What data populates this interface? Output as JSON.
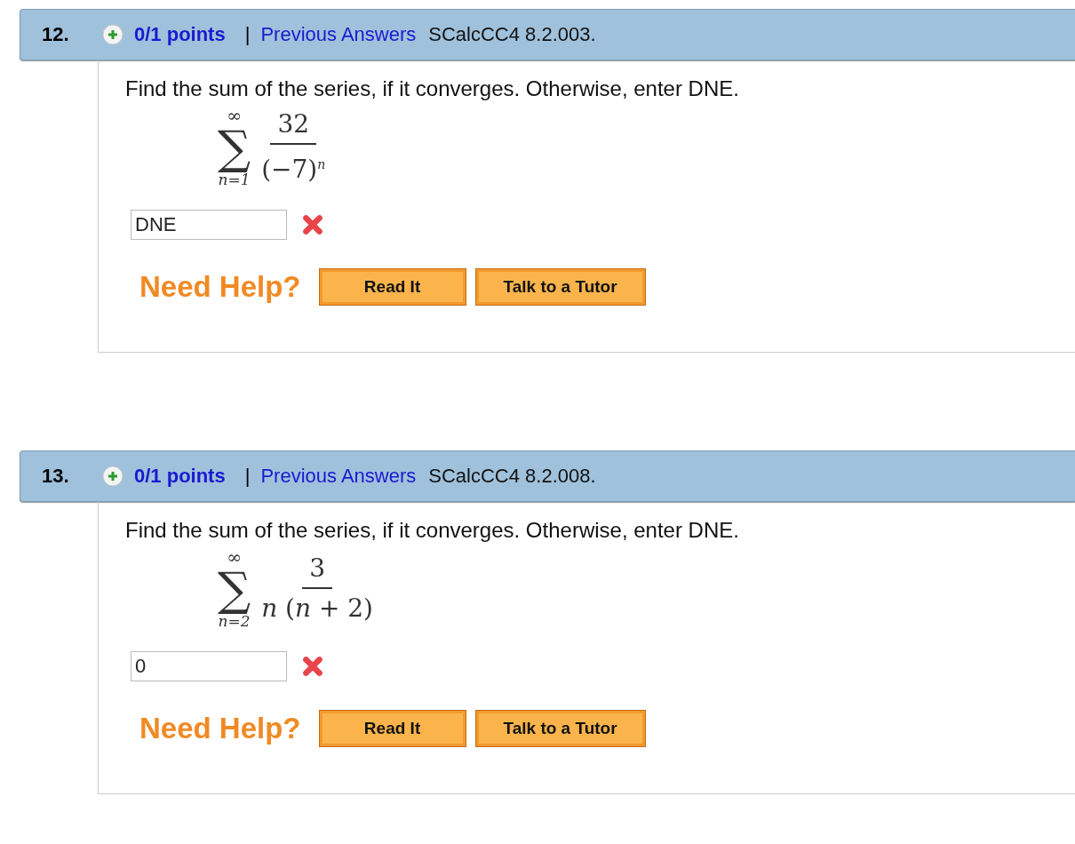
{
  "questions": [
    {
      "number": "12.",
      "points": "0/1 points",
      "separator": "|",
      "link": "Previous Answers",
      "source": "SCalcCC4 8.2.003.",
      "prompt": "Find the sum of the series, if it converges. Otherwise, enter DNE.",
      "sum": {
        "operator": "∑",
        "upper": "∞",
        "lower": "n=1",
        "numerator": "32",
        "denominator": "(−7)$^{n}$"
      },
      "answer": "DNE",
      "correct": false,
      "help": "Need Help?",
      "buttons": [
        "Read It",
        "Talk to a Tutor"
      ]
    },
    {
      "number": "13.",
      "points": "0/1 points",
      "separator": "|",
      "link": "Previous Answers",
      "source": "SCalcCC4 8.2.008.",
      "prompt": "Find the sum of the series, if it converges. Otherwise, enter DNE.",
      "sum": {
        "operator": "∑",
        "upper": "∞",
        "lower": "n=2",
        "numerator": "3",
        "denominator": "*n* (*n* + 2)"
      },
      "answer": "0",
      "correct": false,
      "help": "Need Help?",
      "buttons": [
        "Read It",
        "Talk to a Tutor"
      ]
    }
  ]
}
